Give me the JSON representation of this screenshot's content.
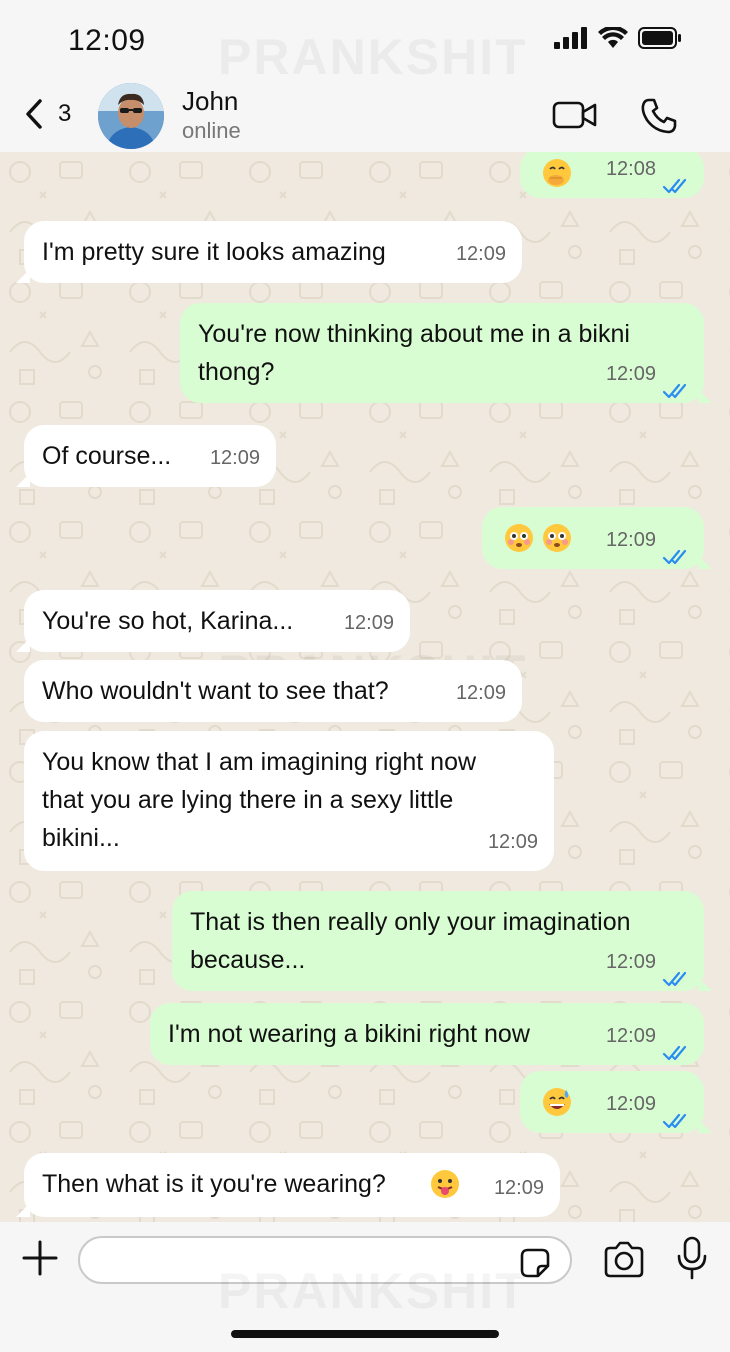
{
  "status_bar": {
    "time": "12:09"
  },
  "watermark": "PRANKSHIT",
  "header": {
    "back_count": "3",
    "contact_name": "John",
    "contact_status": "online"
  },
  "colors": {
    "incoming": "#ffffff",
    "outgoing": "#d8fdd2",
    "read_ticks": "#2a8cf2",
    "chat_bg": "#efe9df"
  },
  "messages": [
    {
      "dir": "out",
      "text": "",
      "emoji": [
        "face-with-hand-over-mouth"
      ],
      "time": "12:08",
      "read": true
    },
    {
      "dir": "in",
      "text": "I'm pretty sure it looks amazing",
      "time": "12:09"
    },
    {
      "dir": "out",
      "text": "You're now thinking about me in a bikni\nthong?",
      "time": "12:09",
      "read": true
    },
    {
      "dir": "in",
      "text": "Of course...",
      "time": "12:09"
    },
    {
      "dir": "out",
      "text": "",
      "emoji": [
        "flushed-face",
        "flushed-face"
      ],
      "time": "12:09",
      "read": true
    },
    {
      "dir": "in",
      "text": "You're so hot, Karina...",
      "time": "12:09"
    },
    {
      "dir": "in",
      "text": "Who wouldn't want to see that?",
      "time": "12:09"
    },
    {
      "dir": "in",
      "text": "You know that I am imagining right now\nthat you are lying there in a sexy little\nbikini...",
      "time": "12:09"
    },
    {
      "dir": "out",
      "text": "That is then really only your imagination\nbecause...",
      "time": "12:09",
      "read": true
    },
    {
      "dir": "out",
      "text": "I'm not wearing a bikini right now",
      "time": "12:09",
      "read": true
    },
    {
      "dir": "out",
      "text": "",
      "emoji": [
        "grinning-face-with-sweat"
      ],
      "time": "12:09",
      "read": true
    },
    {
      "dir": "in",
      "text": "Then what is it you're wearing?",
      "emoji": [
        "face-with-tongue"
      ],
      "time": "12:09"
    }
  ],
  "composer": {
    "value": "",
    "placeholder": ""
  },
  "icons": {
    "back": "chevron-left-icon",
    "video": "video-call-icon",
    "phone": "phone-icon",
    "plus": "plus-icon",
    "sticker": "sticker-icon",
    "camera": "camera-icon",
    "mic": "microphone-icon"
  }
}
